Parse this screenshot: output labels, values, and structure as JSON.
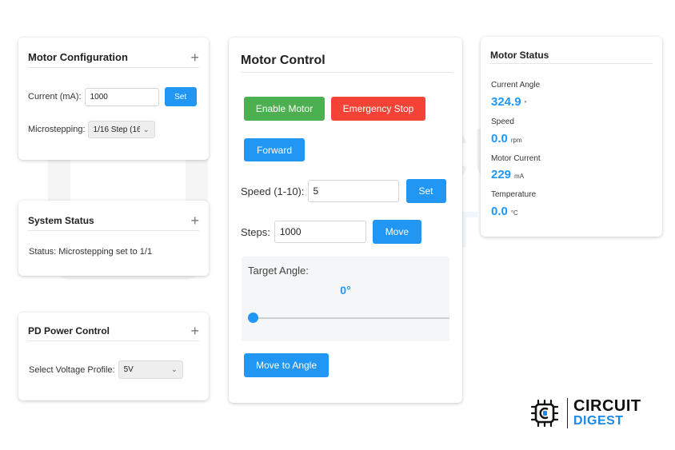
{
  "watermark": {
    "line1": "CIRCUIT",
    "line2": "DIGEST"
  },
  "motor_config": {
    "title": "Motor Configuration",
    "current_label": "Current (mA):",
    "current_value": "1000",
    "set_label": "Set",
    "microstepping_label": "Microstepping:",
    "microstepping_selected": "1/16 Step (16"
  },
  "system_status": {
    "title": "System Status",
    "status_text": "Status: Microstepping set to 1/1"
  },
  "pd_power": {
    "title": "PD Power Control",
    "profile_label": "Select Voltage Profile:",
    "profile_selected": "5V"
  },
  "motor_control": {
    "title": "Motor Control",
    "enable_label": "Enable Motor",
    "estop_label": "Emergency Stop",
    "direction_label": "Forward",
    "speed_label": "Speed (1-10):",
    "speed_value": "5",
    "speed_set_label": "Set",
    "steps_label": "Steps:",
    "steps_value": "1000",
    "move_label": "Move",
    "target_angle_label": "Target Angle:",
    "target_angle_value": "0°",
    "slider_fraction": 0.0,
    "move_to_angle_label": "Move to Angle"
  },
  "motor_status": {
    "title": "Motor Status",
    "angle_label": "Current Angle",
    "angle_value": "324.9",
    "angle_unit": "°",
    "speed_label": "Speed",
    "speed_value": "0.0",
    "speed_unit": "rpm",
    "current_label": "Motor Current",
    "current_value": "229",
    "current_unit": "mA",
    "temp_label": "Temperature",
    "temp_value": "0.0",
    "temp_unit": "°C"
  },
  "logo": {
    "line1": "CIRCUIT",
    "line2": "DIGEST"
  },
  "colors": {
    "accent": "#2196f3",
    "green": "#4caf50",
    "red": "#f44336"
  }
}
